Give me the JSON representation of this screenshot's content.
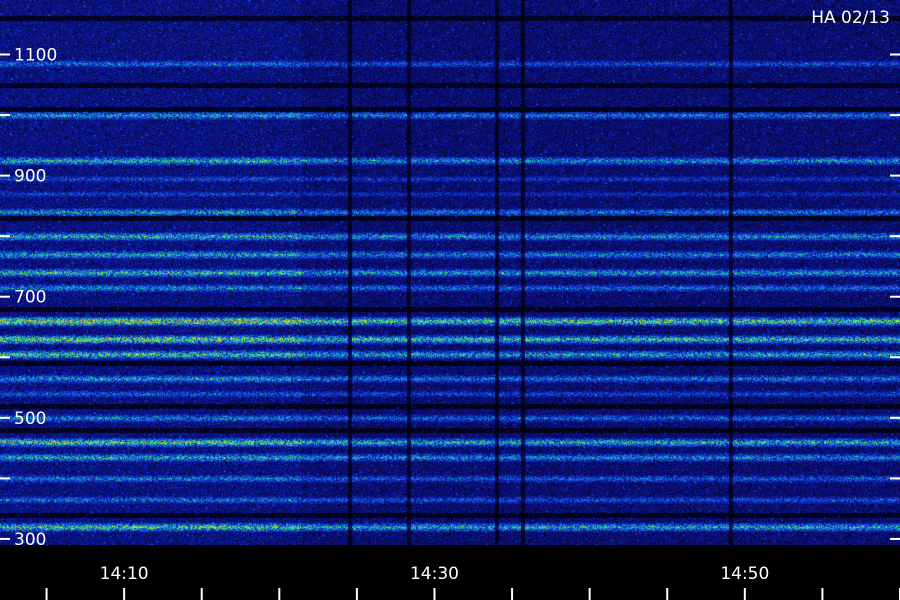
{
  "chart_data": {
    "type": "heatmap",
    "title": "HA 02/13",
    "y_ticks": [
      "1100",
      "900",
      "700",
      "500",
      "300"
    ],
    "y_tick_values": [
      1100,
      900,
      700,
      500,
      300
    ],
    "ylim": [
      290,
      1190
    ],
    "x_ticks": [
      "14:10",
      "14:30",
      "14:50"
    ],
    "x_tick_minutes": [
      10,
      30,
      50
    ],
    "xlim_minutes": [
      2,
      60
    ],
    "x_minor_step_minutes": 5,
    "y_minor_step": 100,
    "colormap": [
      "#000000",
      "#0a0a5c",
      "#0b1aa8",
      "#1040d8",
      "#1a7ad8",
      "#18b4b4",
      "#30e07a",
      "#a0f020",
      "#f0e020",
      "#f06020",
      "#e01010"
    ],
    "noise_level": 0.18,
    "bands": [
      {
        "y": 1085,
        "level": 0.45
      },
      {
        "y": 1000,
        "level": 0.55
      },
      {
        "y": 925,
        "level": 0.62
      },
      {
        "y": 895,
        "level": 0.38
      },
      {
        "y": 870,
        "level": 0.35
      },
      {
        "y": 840,
        "level": 0.55
      },
      {
        "y": 800,
        "level": 0.62
      },
      {
        "y": 770,
        "level": 0.58
      },
      {
        "y": 740,
        "level": 0.65
      },
      {
        "y": 715,
        "level": 0.52
      },
      {
        "y": 660,
        "level": 0.85
      },
      {
        "y": 630,
        "level": 0.78
      },
      {
        "y": 605,
        "level": 0.68
      },
      {
        "y": 565,
        "level": 0.55
      },
      {
        "y": 540,
        "level": 0.42
      },
      {
        "y": 500,
        "level": 0.5
      },
      {
        "y": 460,
        "level": 0.72
      },
      {
        "y": 435,
        "level": 0.6
      },
      {
        "y": 400,
        "level": 0.48
      },
      {
        "y": 365,
        "level": 0.45
      },
      {
        "y": 320,
        "level": 0.7
      }
    ],
    "quiet_bands": [
      1160,
      1050,
      1010,
      830,
      680,
      590,
      520,
      480,
      340
    ],
    "dropouts_minutes": [
      24.5,
      28.3,
      34,
      35.7,
      49.1
    ]
  }
}
